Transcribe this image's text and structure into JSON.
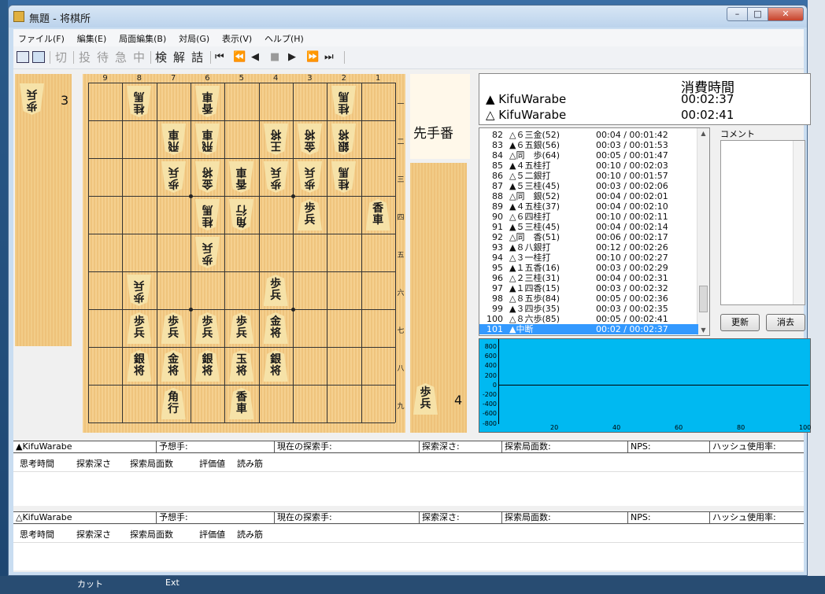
{
  "window": {
    "title": "無題 - 将棋所",
    "min": "–",
    "max": "□",
    "close": "✕"
  },
  "menu": [
    "ファイル(F)",
    "編集(E)",
    "局面編集(B)",
    "対局(G)",
    "表示(V)",
    "ヘルプ(H)"
  ],
  "toolbar": {
    "cut": "切",
    "resign": "投",
    "wait": "待",
    "hurry": "急",
    "stop": "中",
    "study": "検",
    "analyze": "解",
    "mate": "詰",
    "nav": [
      "⏮",
      "⏪",
      "◀",
      "■",
      "▶",
      "⏩",
      "⏭"
    ]
  },
  "board": {
    "files": [
      "9",
      "8",
      "7",
      "6",
      "5",
      "4",
      "3",
      "2",
      "1"
    ],
    "ranks": [
      "一",
      "二",
      "三",
      "四",
      "五",
      "六",
      "七",
      "八",
      "九"
    ],
    "pieces": [
      {
        "file": 8,
        "rank": 1,
        "top": "桂",
        "bot": "馬",
        "gote": true
      },
      {
        "file": 6,
        "rank": 1,
        "top": "香",
        "bot": "車",
        "gote": true
      },
      {
        "file": 2,
        "rank": 1,
        "top": "桂",
        "bot": "馬",
        "gote": true
      },
      {
        "file": 7,
        "rank": 2,
        "top": "飛",
        "bot": "車",
        "gote": true
      },
      {
        "file": 6,
        "rank": 2,
        "top": "飛",
        "bot": "車",
        "gote": true
      },
      {
        "file": 4,
        "rank": 2,
        "top": "王",
        "bot": "将",
        "gote": true
      },
      {
        "file": 3,
        "rank": 2,
        "top": "金",
        "bot": "将",
        "gote": true
      },
      {
        "file": 2,
        "rank": 2,
        "top": "銀",
        "bot": "将",
        "gote": true
      },
      {
        "file": 7,
        "rank": 3,
        "top": "歩",
        "bot": "兵",
        "gote": true
      },
      {
        "file": 6,
        "rank": 3,
        "top": "金",
        "bot": "将",
        "gote": true
      },
      {
        "file": 5,
        "rank": 3,
        "top": "香",
        "bot": "車",
        "gote": true
      },
      {
        "file": 4,
        "rank": 3,
        "top": "歩",
        "bot": "兵",
        "gote": true
      },
      {
        "file": 3,
        "rank": 3,
        "top": "歩",
        "bot": "兵",
        "gote": true
      },
      {
        "file": 2,
        "rank": 3,
        "top": "桂",
        "bot": "馬",
        "gote": true
      },
      {
        "file": 6,
        "rank": 4,
        "top": "桂",
        "bot": "馬",
        "gote": true
      },
      {
        "file": 5,
        "rank": 4,
        "top": "角",
        "bot": "行",
        "gote": true
      },
      {
        "file": 3,
        "rank": 4,
        "top": "歩",
        "bot": "兵",
        "gote": false
      },
      {
        "file": 1,
        "rank": 4,
        "top": "香",
        "bot": "車",
        "gote": false
      },
      {
        "file": 6,
        "rank": 5,
        "top": "歩",
        "bot": "兵",
        "gote": true
      },
      {
        "file": 8,
        "rank": 6,
        "top": "歩",
        "bot": "兵",
        "gote": true
      },
      {
        "file": 4,
        "rank": 6,
        "top": "歩",
        "bot": "兵",
        "gote": false
      },
      {
        "file": 8,
        "rank": 7,
        "top": "歩",
        "bot": "兵",
        "gote": false
      },
      {
        "file": 7,
        "rank": 7,
        "top": "歩",
        "bot": "兵",
        "gote": false
      },
      {
        "file": 6,
        "rank": 7,
        "top": "歩",
        "bot": "兵",
        "gote": false
      },
      {
        "file": 5,
        "rank": 7,
        "top": "歩",
        "bot": "兵",
        "gote": false
      },
      {
        "file": 4,
        "rank": 7,
        "top": "金",
        "bot": "将",
        "gote": false
      },
      {
        "file": 8,
        "rank": 8,
        "top": "銀",
        "bot": "将",
        "gote": false
      },
      {
        "file": 7,
        "rank": 8,
        "top": "金",
        "bot": "将",
        "gote": false
      },
      {
        "file": 6,
        "rank": 8,
        "top": "銀",
        "bot": "将",
        "gote": false
      },
      {
        "file": 5,
        "rank": 8,
        "top": "玉",
        "bot": "将",
        "gote": false
      },
      {
        "file": 4,
        "rank": 8,
        "top": "銀",
        "bot": "将",
        "gote": false
      },
      {
        "file": 7,
        "rank": 9,
        "top": "角",
        "bot": "行",
        "gote": false
      },
      {
        "file": 5,
        "rank": 9,
        "top": "香",
        "bot": "車",
        "gote": false
      }
    ]
  },
  "gote_hand": {
    "top": "歩",
    "bot": "兵",
    "count": "3"
  },
  "sente_hand": {
    "top": "歩",
    "bot": "兵",
    "count": "4"
  },
  "turn": "先手番",
  "players": {
    "time_label": "消費時間",
    "sente_name": "▲ KifuWarabe",
    "sente_time": "00:02:37",
    "gote_name": "△ KifuWarabe",
    "gote_time": "00:02:41"
  },
  "moves": [
    {
      "n": "82",
      "m": "△６三金(52)",
      "t": "00:04 / 00:01:42"
    },
    {
      "n": "83",
      "m": "▲６五銀(56)",
      "t": "00:03 / 00:01:53"
    },
    {
      "n": "84",
      "m": "△同　歩(64)",
      "t": "00:05 / 00:01:47"
    },
    {
      "n": "85",
      "m": "▲４五桂打",
      "t": "00:10 / 00:02:03"
    },
    {
      "n": "86",
      "m": "△５二銀打",
      "t": "00:10 / 00:01:57"
    },
    {
      "n": "87",
      "m": "▲５三桂(45)",
      "t": "00:03 / 00:02:06"
    },
    {
      "n": "88",
      "m": "△同　銀(52)",
      "t": "00:04 / 00:02:01"
    },
    {
      "n": "89",
      "m": "▲４五桂(37)",
      "t": "00:04 / 00:02:10"
    },
    {
      "n": "90",
      "m": "△６四桂打",
      "t": "00:10 / 00:02:11"
    },
    {
      "n": "91",
      "m": "▲５三桂(45)",
      "t": "00:04 / 00:02:14"
    },
    {
      "n": "92",
      "m": "△同　香(51)",
      "t": "00:06 / 00:02:17"
    },
    {
      "n": "93",
      "m": "▲８八銀打",
      "t": "00:12 / 00:02:26"
    },
    {
      "n": "94",
      "m": "△３一桂打",
      "t": "00:10 / 00:02:27"
    },
    {
      "n": "95",
      "m": "▲１五香(16)",
      "t": "00:03 / 00:02:29"
    },
    {
      "n": "96",
      "m": "△２三桂(31)",
      "t": "00:04 / 00:02:31"
    },
    {
      "n": "97",
      "m": "▲１四香(15)",
      "t": "00:03 / 00:02:32"
    },
    {
      "n": "98",
      "m": "△８五歩(84)",
      "t": "00:05 / 00:02:36"
    },
    {
      "n": "99",
      "m": "▲３四歩(35)",
      "t": "00:03 / 00:02:35"
    },
    {
      "n": "100",
      "m": "△８六歩(85)",
      "t": "00:05 / 00:02:41"
    },
    {
      "n": "101",
      "m": "▲中断",
      "t": "00:02 / 00:02:37",
      "selected": true
    }
  ],
  "comment": {
    "label": "コメント",
    "update": "更新",
    "clear": "消去"
  },
  "graph": {
    "y_ticks": [
      "800",
      "600",
      "400",
      "200",
      "0",
      "-200",
      "-400",
      "-600",
      "-800"
    ],
    "x_ticks": [
      "20",
      "40",
      "60",
      "80",
      "100"
    ]
  },
  "engine1": {
    "name": "▲KifuWarabe",
    "pred": "予想手:",
    "current": "現在の探索手:",
    "depth": "探索深さ:",
    "nodes": "探索局面数:",
    "nps": "NPS:",
    "hash": "ハッシュ使用率:",
    "cols": [
      "思考時間",
      "探索深さ",
      "探索局面数",
      "評価値",
      "読み筋"
    ]
  },
  "engine2": {
    "name": "△KifuWarabe",
    "pred": "予想手:",
    "current": "現在の探索手:",
    "depth": "探索深さ:",
    "nodes": "探索局面数:",
    "nps": "NPS:",
    "hash": "ハッシュ使用率:",
    "cols": [
      "思考時間",
      "探索深さ",
      "探索局面数",
      "評価値",
      "読み筋"
    ]
  },
  "taskbar": {
    "left": "カット",
    "right": "Ext"
  },
  "colors": {
    "graph_bg": "#00b9f1",
    "selected_row": "#3399ff",
    "board": "#f2c882"
  }
}
